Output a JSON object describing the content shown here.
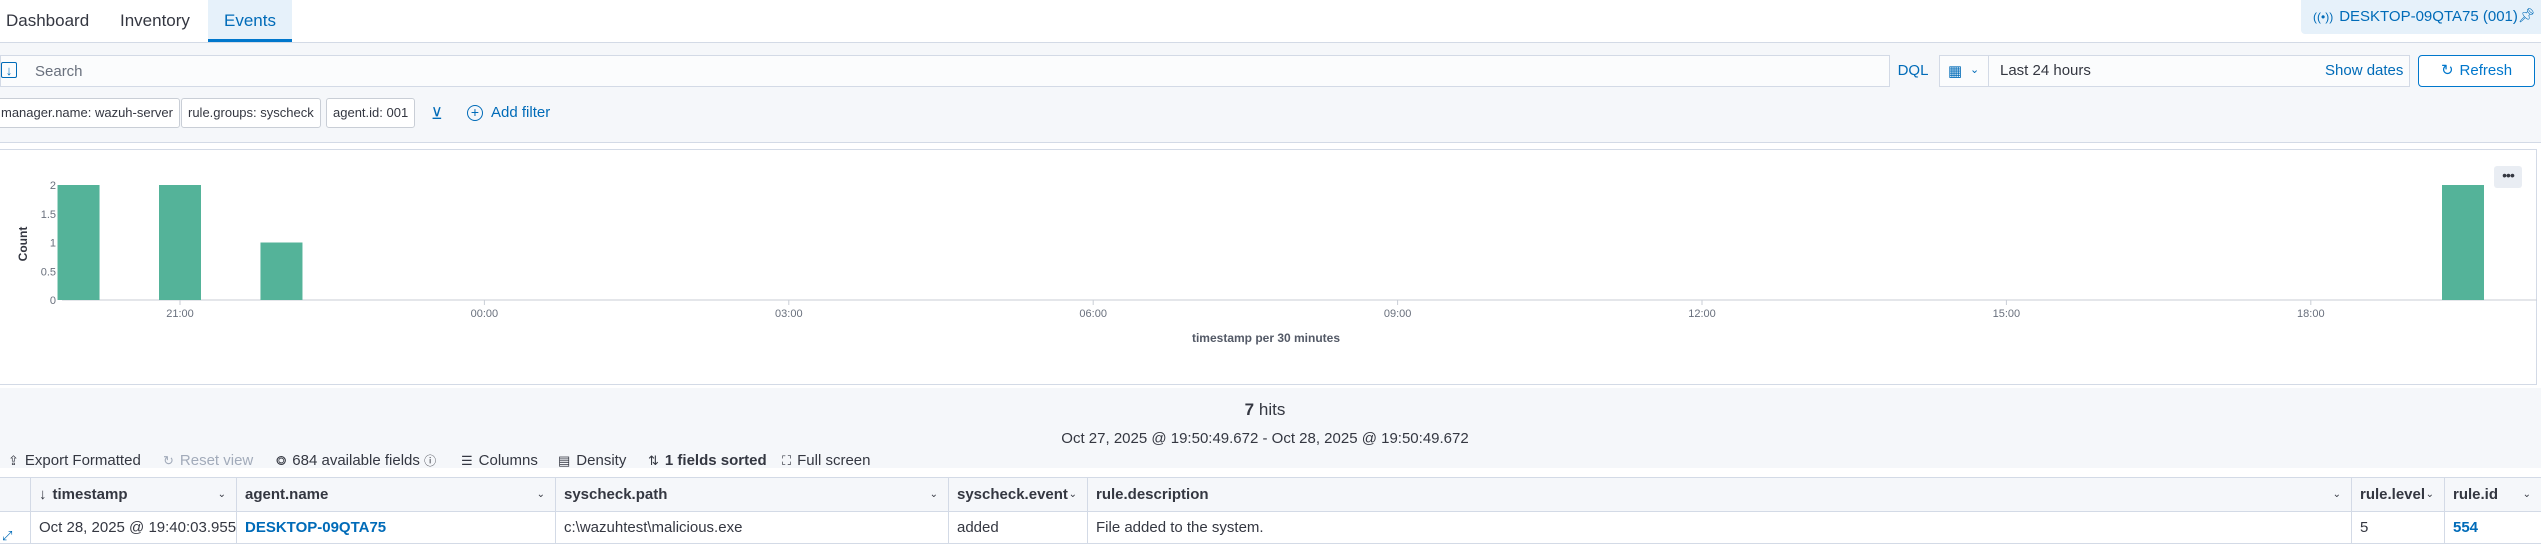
{
  "tabs": [
    {
      "label": "Dashboard"
    },
    {
      "label": "Inventory"
    },
    {
      "label": "Events"
    }
  ],
  "agent": {
    "label": "DESKTOP-09QTA75 (001)"
  },
  "search": {
    "placeholder": "Search",
    "language": "DQL"
  },
  "date": {
    "range": "Last 24 hours",
    "show_dates": "Show dates"
  },
  "refresh_label": "Refresh",
  "filters": [
    "manager.name: wazuh-server",
    "rule.groups: syscheck",
    "agent.id: 001"
  ],
  "add_filter": "Add filter",
  "chart_data": {
    "type": "bar",
    "xlabel": "timestamp per 30 minutes",
    "ylabel": "Count",
    "ylim": [
      0,
      2
    ],
    "y_ticks": [
      "0",
      "0.5",
      "1",
      "1.5",
      "2"
    ],
    "x_ticks": [
      "21:00",
      "00:00",
      "03:00",
      "06:00",
      "09:00",
      "12:00",
      "15:00",
      "18:00"
    ],
    "categories": [
      "20:00",
      "21:00",
      "22:00",
      "19:30"
    ],
    "values": [
      2,
      2,
      1,
      2
    ],
    "color": "#54b399"
  },
  "hits": {
    "count": "7",
    "label": "hits",
    "range": "Oct 27, 2025 @ 19:50:49.672 - Oct 28, 2025 @ 19:50:49.672"
  },
  "toolbar": {
    "export": "Export Formatted",
    "reset": "Reset view",
    "fields": "684 available fields",
    "columns": "Columns",
    "density": "Density",
    "sorted": "1 fields sorted",
    "fullscreen": "Full screen"
  },
  "table": {
    "headers": [
      "timestamp",
      "agent.name",
      "syscheck.path",
      "syscheck.event",
      "rule.description",
      "rule.level",
      "rule.id"
    ],
    "rows": [
      [
        "Oct 28, 2025 @ 19:40:03.955",
        "DESKTOP-09QTA75",
        "c:\\wazuhtest\\malicious.exe",
        "added",
        "File added to the system.",
        "5",
        "554"
      ]
    ]
  }
}
